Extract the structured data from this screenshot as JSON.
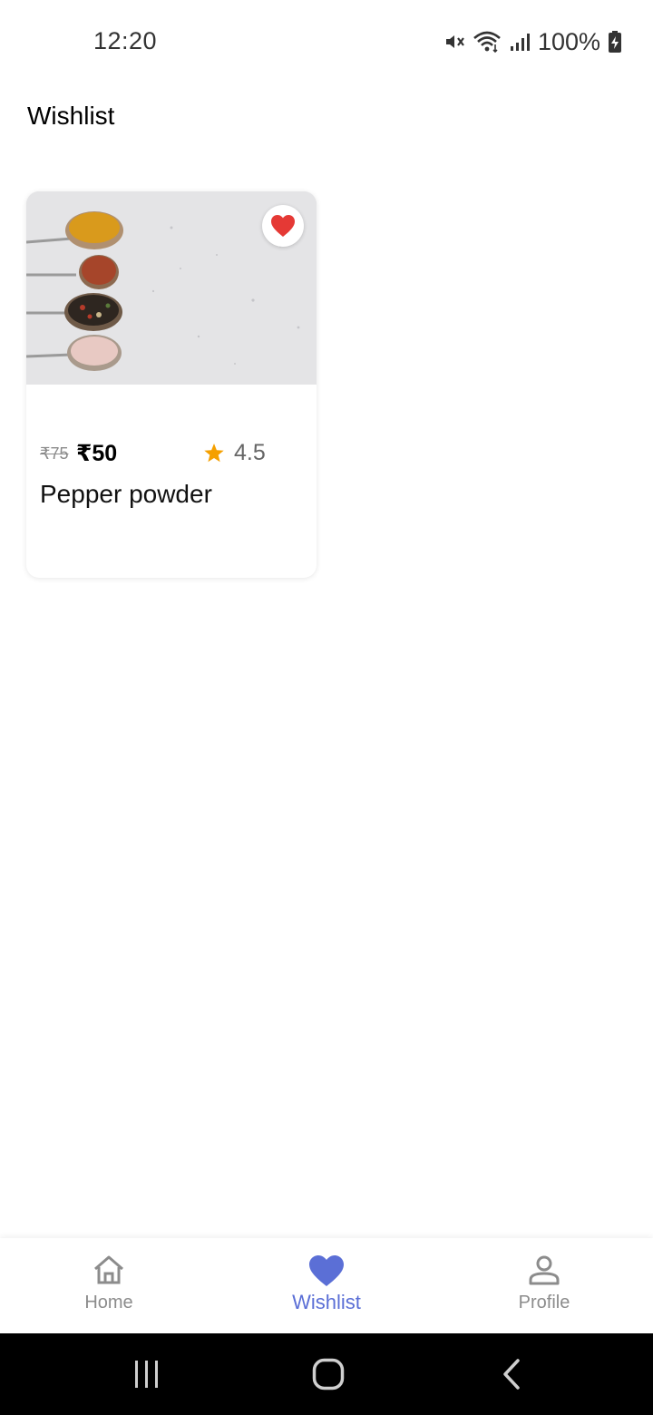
{
  "status_bar": {
    "time": "12:20",
    "battery": "100%",
    "icons": [
      "mute-icon",
      "wifi-icon",
      "signal-icon",
      "battery-charging-icon"
    ]
  },
  "page": {
    "title": "Wishlist"
  },
  "wishlist_items": [
    {
      "name": "Pepper powder",
      "old_price": "₹75",
      "price": "₹50",
      "rating": "4.5",
      "favorited": true,
      "image": "spices-on-spoons"
    }
  ],
  "bottom_nav": {
    "items": [
      {
        "label": "Home",
        "icon": "home-icon",
        "active": false
      },
      {
        "label": "Wishlist",
        "icon": "heart-icon",
        "active": true
      },
      {
        "label": "Profile",
        "icon": "profile-icon",
        "active": false
      }
    ]
  },
  "colors": {
    "accent": "#5b6fd6",
    "favorite": "#e53935",
    "star": "#f5a000"
  }
}
